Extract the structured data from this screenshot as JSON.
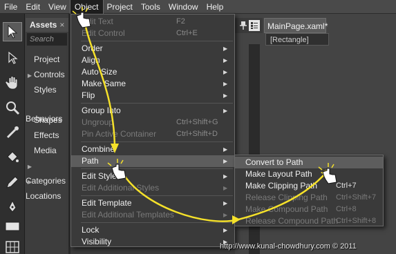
{
  "menubar": {
    "items": [
      "File",
      "Edit",
      "View",
      "Object",
      "Project",
      "Tools",
      "Window",
      "Help"
    ]
  },
  "assets": {
    "tab_label": "Assets",
    "tab_close": "×",
    "search_placeholder": "Search",
    "items": [
      {
        "label": "Project",
        "expand": ""
      },
      {
        "label": "Controls",
        "expand": "▶"
      },
      {
        "label": "Styles",
        "expand": ""
      },
      {
        "label": "Behaviors",
        "expand": ""
      },
      {
        "label": "Shapes",
        "expand": ""
      },
      {
        "label": "Effects",
        "expand": ""
      },
      {
        "label": "Media",
        "expand": ""
      },
      {
        "label": "Categories",
        "expand": "▶"
      },
      {
        "label": "Locations",
        "expand": "▶"
      }
    ]
  },
  "document": {
    "tab_label": "MainPage.xaml*",
    "tab_close": "×",
    "breadcrumb": "[Rectangle]"
  },
  "object_menu": {
    "items": [
      {
        "label": "Edit Text",
        "shortcut": "F2",
        "disabled": true
      },
      {
        "label": "Edit Control",
        "shortcut": "Ctrl+E",
        "disabled": true
      },
      {
        "label": "Order",
        "submenu": true
      },
      {
        "label": "Align",
        "submenu": true
      },
      {
        "label": "Auto Size",
        "submenu": true
      },
      {
        "label": "Make Same",
        "submenu": true
      },
      {
        "label": "Flip",
        "submenu": true
      },
      {
        "label": "Group Into",
        "submenu": true
      },
      {
        "label": "Ungroup",
        "shortcut": "Ctrl+Shift+G",
        "disabled": true
      },
      {
        "label": "Pin Active Container",
        "shortcut": "Ctrl+Shift+D",
        "disabled": true
      },
      {
        "label": "Combine",
        "submenu": true
      },
      {
        "label": "Path",
        "submenu": true,
        "highlighted": true
      },
      {
        "label": "Edit Style",
        "submenu": true
      },
      {
        "label": "Edit Additional Styles",
        "submenu": true,
        "disabled": true
      },
      {
        "label": "Edit Template",
        "submenu": true
      },
      {
        "label": "Edit Additional Templates",
        "submenu": true,
        "disabled": true
      },
      {
        "label": "Lock",
        "submenu": true
      },
      {
        "label": "Visibility",
        "submenu": true
      }
    ]
  },
  "path_submenu": {
    "items": [
      {
        "label": "Convert to Path",
        "shortcut": "",
        "highlighted": true
      },
      {
        "label": "Make Layout Path",
        "shortcut": ""
      },
      {
        "label": "Make Clipping Path",
        "shortcut": "Ctrl+7"
      },
      {
        "label": "Release Clipping Path",
        "shortcut": "Ctrl+Shift+7",
        "disabled": true
      },
      {
        "label": "Make Compound Path",
        "shortcut": "Ctrl+8",
        "disabled": true
      },
      {
        "label": "Release Compound Path",
        "shortcut": "Ctrl+Shift+8",
        "disabled": true
      }
    ]
  },
  "credit": "http://www.kunal-chowdhury.com © 2011",
  "colors": {
    "annotation_arrow": "#f5e12a",
    "menu_bg": "#3a3a3a",
    "highlight": "#5d5d5d"
  },
  "icons": [
    "selection-arrow-icon",
    "direct-selection-icon",
    "pan-hand-icon",
    "zoom-magnifier-icon",
    "eyedropper-icon",
    "paint-bucket-icon",
    "pencil-icon",
    "pen-icon",
    "rectangle-icon",
    "grid-icon",
    "pin-icon",
    "list-view-icon",
    "hand-cursor-icon"
  ]
}
